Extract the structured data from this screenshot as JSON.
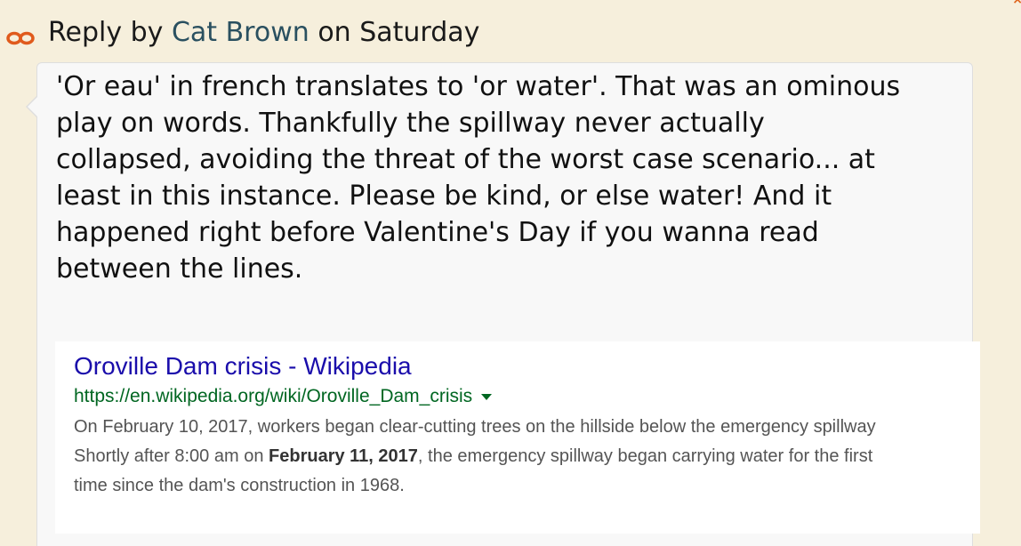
{
  "corner": {
    "close_glyph": "×"
  },
  "reply": {
    "prefix": "Reply by",
    "author": "Cat Brown",
    "suffix": "on Saturday",
    "icon": "link-icon",
    "author_color": "#2a5060"
  },
  "comment": {
    "lines": [
      "'Or eau' in french translates to 'or water'. That was an ominous",
      "play on words. Thankfully the spillway never actually",
      "collapsed, avoiding the threat of the worst case scenario... at",
      "least in this instance. Please be kind, or else water! And it",
      "happened right before Valentine's Day if you wanna read",
      "between the lines."
    ]
  },
  "search_result": {
    "title": "Oroville Dam crisis - Wikipedia",
    "url": "https://en.wikipedia.org/wiki/Oroville_Dam_crisis",
    "url_menu_icon": "caret-down-icon",
    "snippet": {
      "line1": "On February 10, 2017, workers began clear-cutting trees on the hillside below the emergency spillway",
      "line2_before": "Shortly after 8:00 am on ",
      "line2_bold": "February 11, 2017",
      "line2_after": ", the emergency spillway began carrying water for the first",
      "line3": "time since the dam's construction in 1968."
    },
    "title_color": "#1a0dab",
    "url_color": "#006621"
  }
}
